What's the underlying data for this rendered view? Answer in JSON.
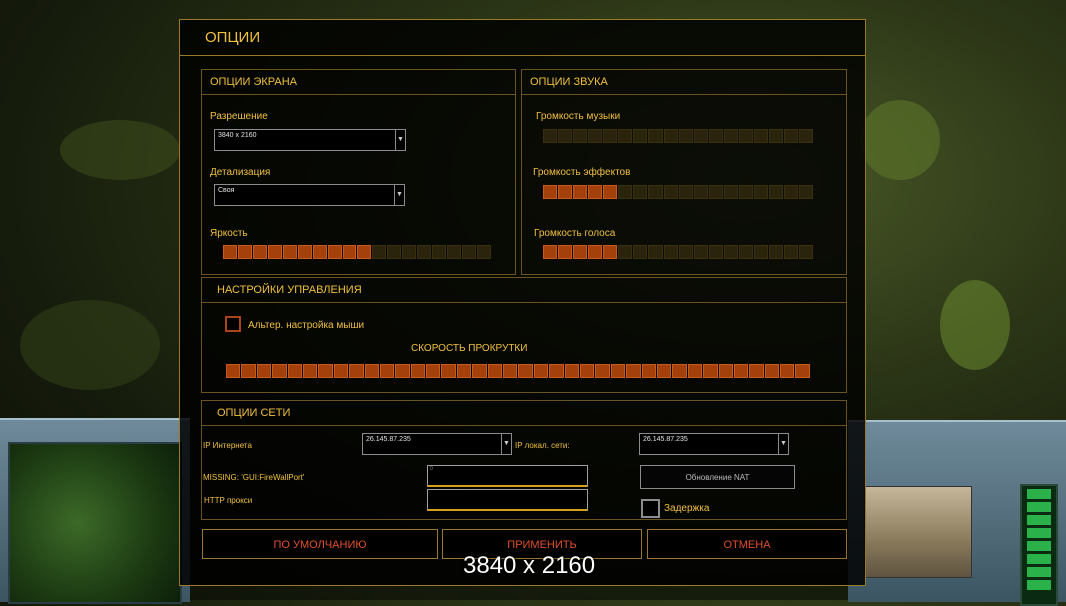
{
  "dialog": {
    "title": "ОПЦИИ"
  },
  "screen": {
    "header": "ОПЦИИ ЭКРАНА",
    "resolution_label": "Разрешение",
    "resolution_value": "3840 x 2160",
    "detail_label": "Детализация",
    "detail_value": "Своя",
    "brightness_label": "Яркость",
    "brightness_level": 0.55
  },
  "sound": {
    "header": "ОПЦИИ ЗВУКА",
    "music_label": "Громкость музыки",
    "music_level": 0,
    "effects_label": "Громкость эффектов",
    "effects_level": 0.28,
    "voice_label": "Громкость голоса",
    "voice_level": 0.28
  },
  "controls": {
    "header": "НАСТРОЙКИ УПРАВЛЕНИЯ",
    "alt_mouse_label": "Альтер. настройка мыши",
    "alt_mouse_checked": false,
    "scroll_speed_label": "СКОРОСТЬ ПРОКРУТКИ",
    "scroll_speed_level": 1.0
  },
  "network": {
    "header": "ОПЦИИ СЕТИ",
    "internet_ip_label": "IP Интернета",
    "internet_ip_value": "26.145.87.235",
    "local_ip_label": "IP локал. сети:",
    "local_ip_value": "26.145.87.235",
    "firewall_label": "MISSING: 'GUI:FireWallPort'",
    "firewall_value": "0",
    "http_proxy_label": "HTTP прокси",
    "http_proxy_value": "",
    "nat_button": "Обновление NAT",
    "delay_label": "Задержка",
    "delay_checked": false
  },
  "buttons": {
    "defaults": "ПО УМОЛЧАНИЮ",
    "apply": "ПРИМЕНИТЬ",
    "cancel": "ОТМЕНА"
  },
  "overlay_caption": "3840 x 2160",
  "colors": {
    "accent": "#f0c040",
    "button_text": "#e0502a",
    "slider_on": "#a4400c",
    "slider_off": "#2b240c"
  }
}
